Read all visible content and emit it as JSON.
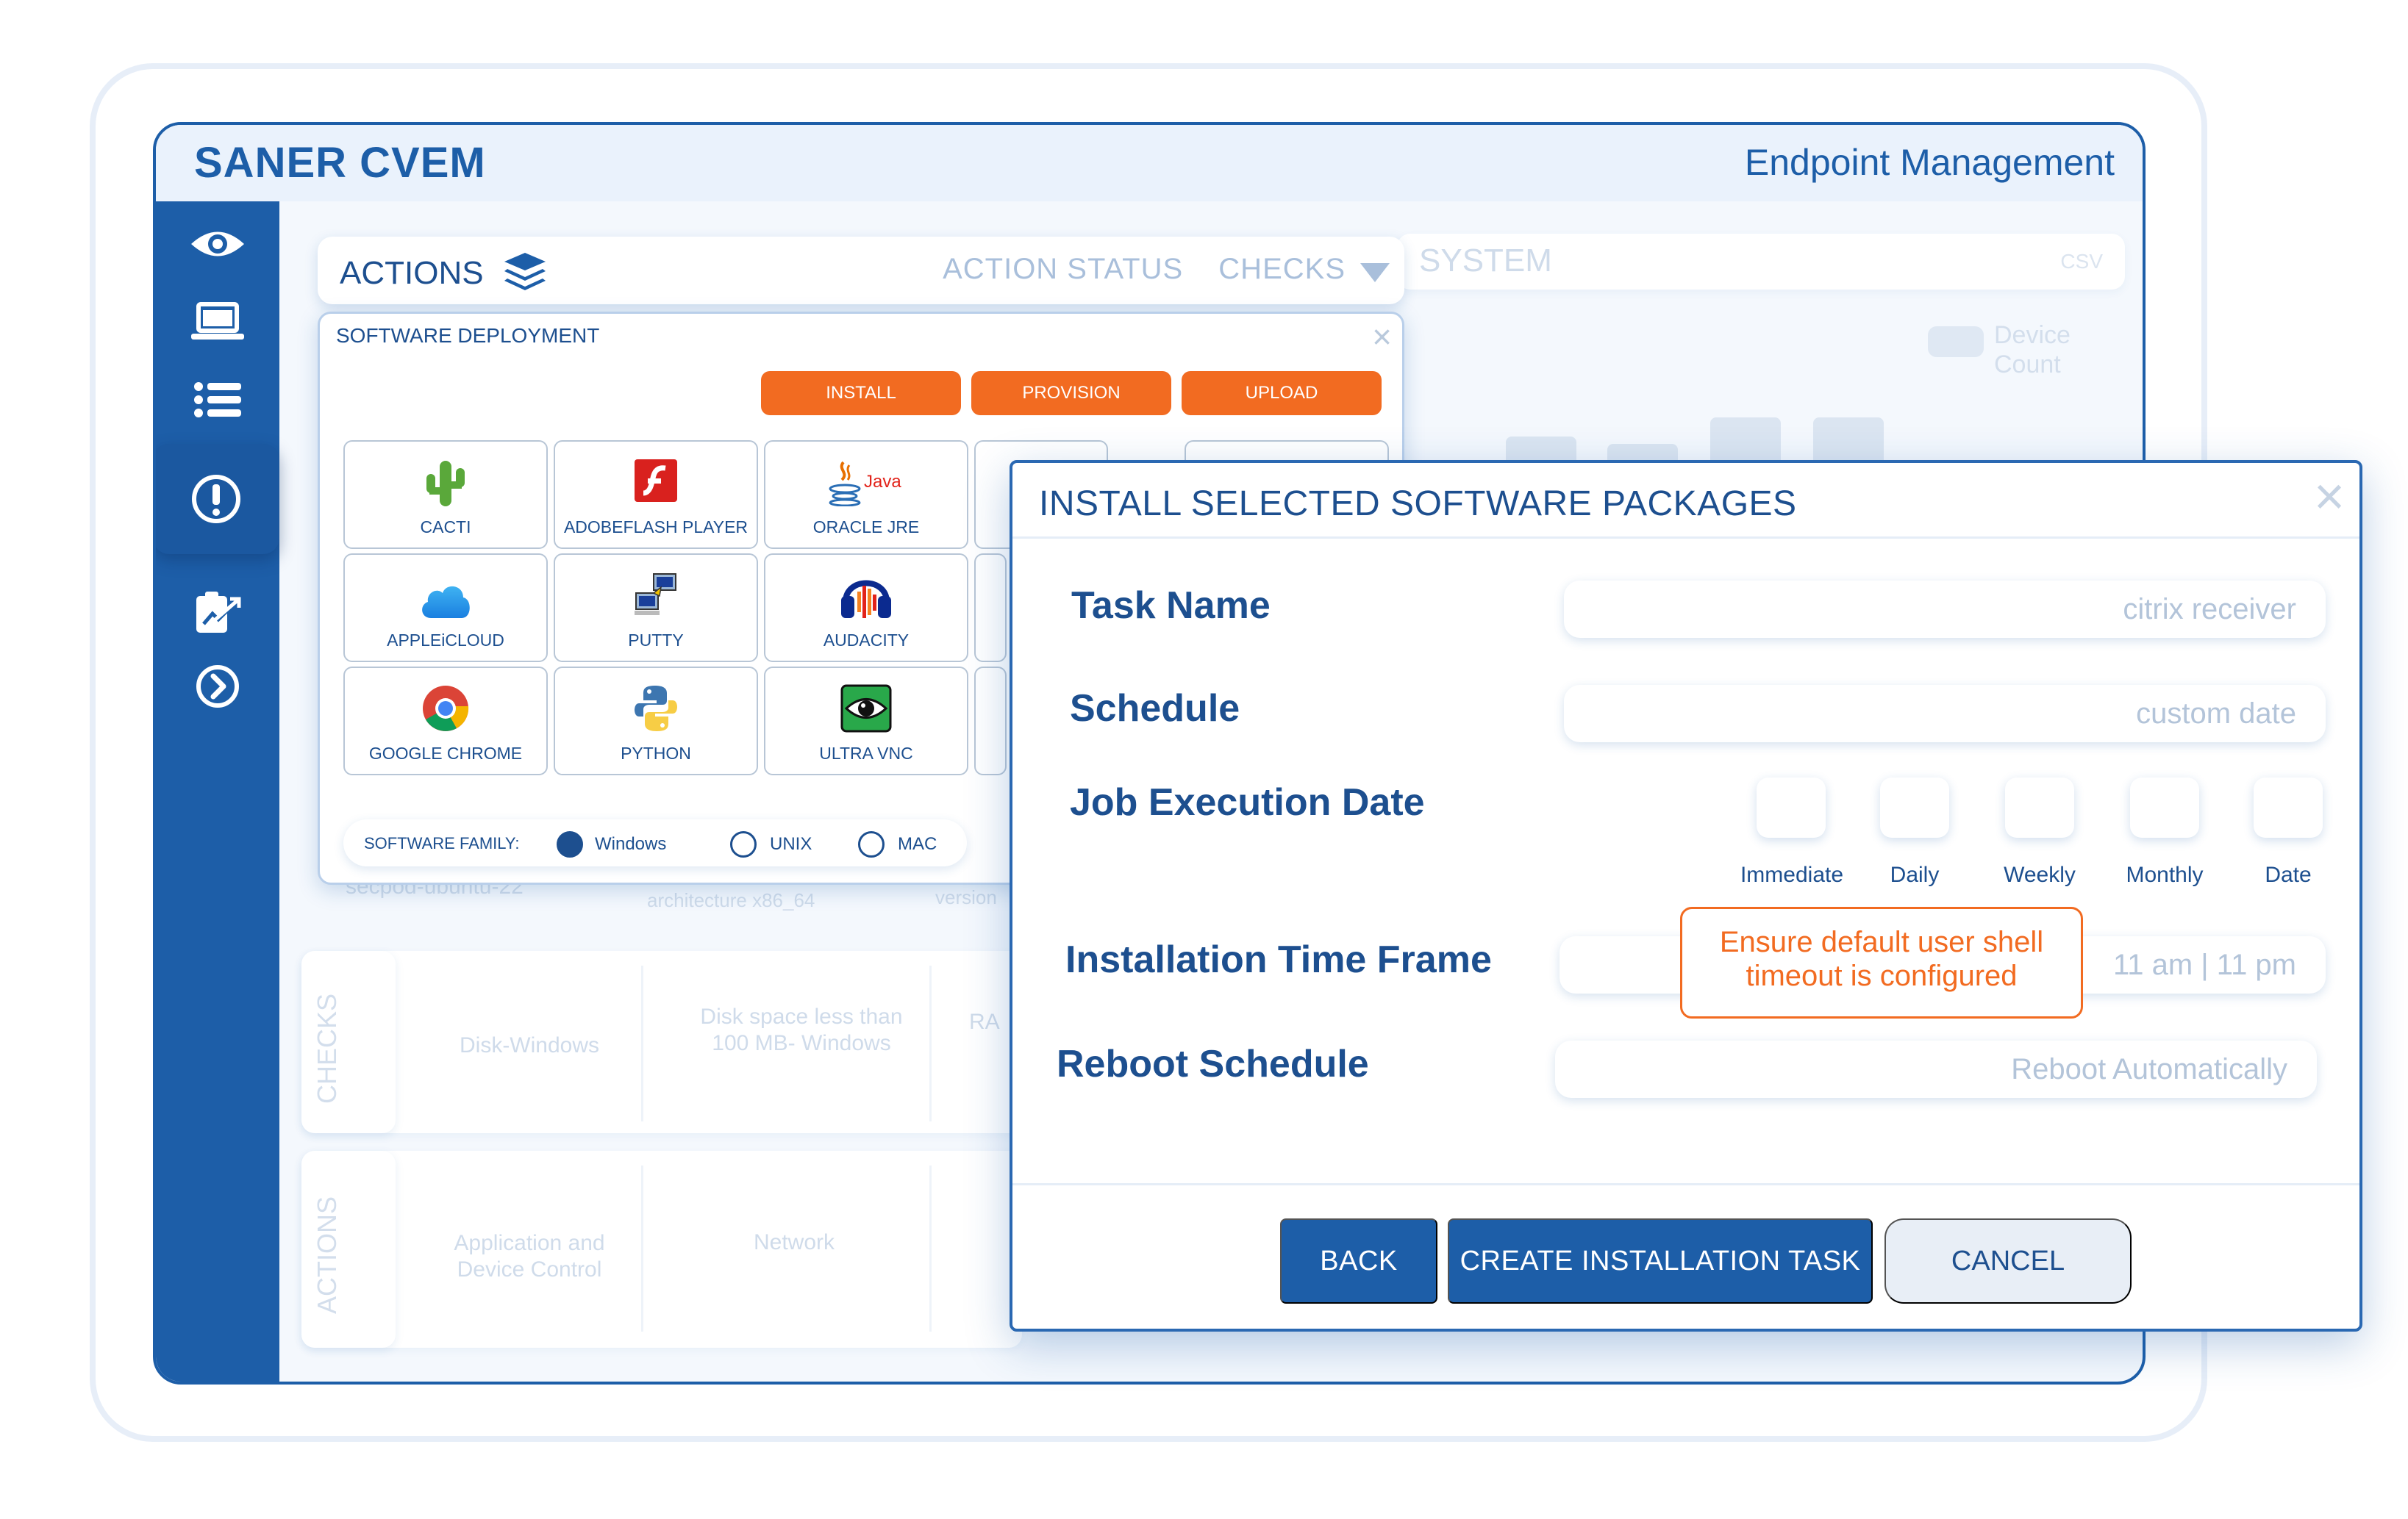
{
  "header": {
    "brand": "SANER CVEM",
    "module": "Endpoint Management"
  },
  "sidebar": {
    "items": [
      {
        "icon": "eye-icon"
      },
      {
        "icon": "laptop-icon"
      },
      {
        "icon": "list-icon"
      },
      {
        "icon": "alert-icon",
        "active": true
      },
      {
        "icon": "report-icon"
      },
      {
        "icon": "chevron-right-icon"
      }
    ]
  },
  "actions": {
    "title": "ACTIONS",
    "tabs": [
      "ACTION STATUS",
      "CHECKS"
    ]
  },
  "background": {
    "system_title": "SYSTEM",
    "csv_label": "CSV",
    "legend_label": "Device Count",
    "host_text": "secpod-ubuntu-22",
    "arch_text": "architecture x86_64",
    "version_text": "version",
    "checks_tab": "CHECKS",
    "actions_tab": "ACTIONS",
    "checks_cells": [
      "Disk-Windows",
      "Disk space less than 100 MB- Windows",
      "RA"
    ],
    "actions_cells": [
      "Application and Device Control",
      "Network"
    ]
  },
  "deployment": {
    "title": "SOFTWARE DEPLOYMENT",
    "buttons": [
      "INSTALL",
      "PROVISION",
      "UPLOAD"
    ],
    "tiles": [
      {
        "label": "CACTI",
        "icon": "cactus-icon"
      },
      {
        "label": "ADOBEFLASH PLAYER",
        "icon": "flash-icon"
      },
      {
        "label": "ORACLE JRE",
        "icon": "java-icon",
        "icon_text": "Java"
      },
      {
        "label": "APPLEiCLOUD",
        "icon": "cloud-icon"
      },
      {
        "label": "PUTTY",
        "icon": "putty-icon"
      },
      {
        "label": "AUDACITY",
        "icon": "headphones-icon"
      },
      {
        "label": "GOOGLE CHROME",
        "icon": "chrome-icon"
      },
      {
        "label": "PYTHON",
        "icon": "python-icon"
      },
      {
        "label": "ULTRA VNC",
        "icon": "vnc-eye-icon"
      }
    ],
    "family": {
      "label": "SOFTWARE FAMILY:",
      "options": [
        {
          "label": "Windows",
          "checked": true
        },
        {
          "label": "UNIX",
          "checked": false
        },
        {
          "label": "MAC",
          "checked": false
        }
      ]
    }
  },
  "dialog": {
    "title": "INSTALL SELECTED SOFTWARE PACKAGES",
    "fields": {
      "task_name": {
        "label": "Task Name",
        "value": "citrix receiver"
      },
      "schedule": {
        "label": "Schedule",
        "value": "custom date"
      },
      "job_date": {
        "label": "Job Execution Date",
        "options": [
          "Immediate",
          "Daily",
          "Weekly",
          "Monthly",
          "Date"
        ]
      },
      "time_frame": {
        "label": "Installation Time Frame",
        "value": "11 am | 11 pm"
      },
      "reboot": {
        "label": "Reboot Schedule",
        "value": "Reboot Automatically"
      }
    },
    "tooltip": "Ensure default user shell timeout is configured",
    "buttons": {
      "back": "BACK",
      "create": "CREATE INSTALLATION TASK",
      "cancel": "CANCEL"
    }
  },
  "colors": {
    "primary": "#1d5ea8",
    "accent": "#f26b21",
    "muted": "#b3c4d9"
  }
}
